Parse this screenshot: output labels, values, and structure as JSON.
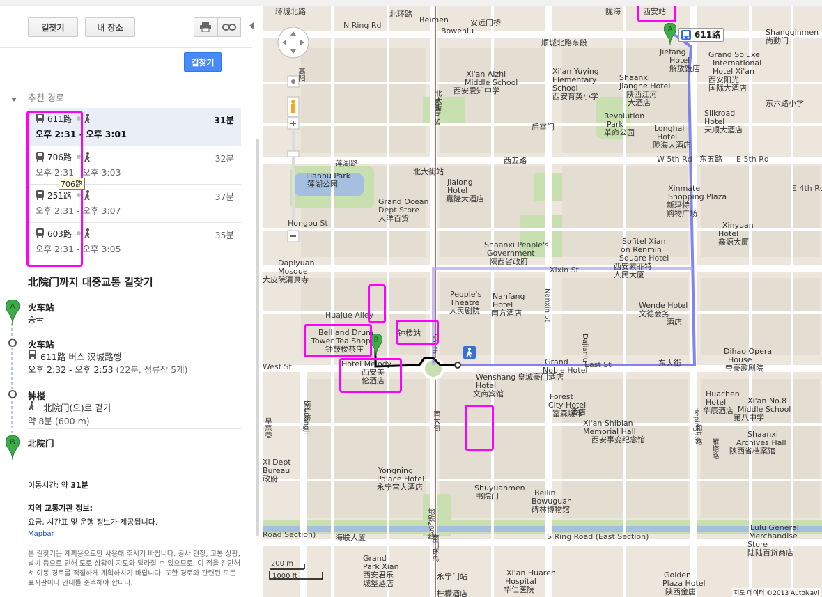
{
  "toolbar": {
    "directions_label": "길찾기",
    "my_places_label": "내 장소",
    "go_label": "길찾기"
  },
  "routes_header": "추천 경로",
  "routes": [
    {
      "line": "611路",
      "time": "오후 2:31 - 오후 3:01",
      "duration": "31분"
    },
    {
      "line": "706路",
      "time": "오후 2:31 - 오후 3:03",
      "duration": "32분",
      "tooltip": "706路"
    },
    {
      "line": "251路",
      "time": "오후 2:31 - 오후 3:07",
      "duration": "37분"
    },
    {
      "line": "603路",
      "time": "오후 2:31 - 오후 3:05",
      "duration": "35분"
    }
  ],
  "directions": {
    "title": "北院门까지 대중교통 길찾기",
    "steps": [
      {
        "name": "火车站",
        "sub": "중국",
        "marker": "A"
      },
      {
        "name": "火车站",
        "bus": "611路 버스 汉城路행",
        "time": "오후 2:32 - 오후 2:53",
        "detail": "(22분, 정류장 5개)"
      },
      {
        "name": "钟楼",
        "walk": "北院门(으)로 걷기",
        "dist": "약 8분 (600 m)"
      },
      {
        "name": "北院门",
        "marker": "B"
      }
    ],
    "travel_time_label": "이동시간: 약 ",
    "travel_time_value": "31분",
    "agency_title": "지역 교통기관 정보:",
    "agency_desc": "요금, 시간표 및 운행 정보가 제공됩니다.",
    "agency_link": "Mapbar",
    "disclaimer": "본 길찾기는 계획용으로만 사용해 주시기 바랍니다. 공사 현장, 교통 상황, 날씨 등으로 인해 도로 상황이 지도와 달라질 수 있으므로, 이 점을 감안해서 이동 경로를 적절하게 계획하시기 바랍니다. 또한 경로와 관련된 모든 표지판이나 안내를 준수해야 합니다."
  },
  "map": {
    "route_badge": "611路",
    "scale_m": "200 m",
    "scale_ft": "1000 ft",
    "copyright": "지도 데이터 ©2013 AutoNavi",
    "labels": [
      "环城北路",
      "陇海",
      "西安站",
      "N Ring Rd",
      "北环路",
      "Beimen",
      "Bowenlu",
      "安远门桥",
      "顺城北路东段",
      "Jiefang",
      "Hotel",
      "解放饭店",
      "Grand Soluxe",
      "International",
      "Hotel Xi'an",
      "西安阳光",
      "国际大酒店",
      "Shangqinmen",
      "尚勤门",
      "Xi'an Aizhi",
      "Middle School",
      "西安爱知中学",
      "Xi'an Yuying",
      "Elementary",
      "School",
      "西安育英小学",
      "Shaanxi",
      "Jianghe Hotel",
      "陕西江河",
      "大酒店",
      "东六路小学",
      "Revolution",
      "Park",
      "革命公园",
      "后宰门",
      "Longhai",
      "Hotel",
      "陇海大酒店",
      "Silkroad",
      "Hotel",
      "天顺大酒店",
      "莲湖路",
      "西五路",
      "W 5th Rd",
      "东五路",
      "E 5th Rd",
      "Lianhu Park",
      "莲湖公园",
      "北大街站",
      "Jialong",
      "Hotel",
      "嘉隆大酒店",
      "Grand Ocean",
      "Dept Store",
      "大洋百货",
      "Xinmate",
      "Shopping Plaza",
      "新玛特",
      "购物广场",
      "E 4th Rd",
      "Xinyuan",
      "Hotel",
      "鑫源大厦",
      "Shaanxi People's",
      "Government",
      "陕西省政府",
      "Sofitel Xian",
      "on Renmin",
      "Square Hotel",
      "西安索菲特",
      "人民大厦",
      "Xixin St",
      "Hongbu St",
      "Dapiyuan",
      "Mosque",
      "大皮院清真寺",
      "People's",
      "Theatre",
      "人民剧院",
      "Nanfang",
      "Hotel",
      "南方酒店",
      "Wende Hotel",
      "文德会务",
      "酒店",
      "Huajue Alley",
      "Bell and Drum",
      "Tower Tea Shop",
      "钟鼓楼茶庄",
      "钟楼站",
      "Hotel Melody",
      "西安美",
      "伦酒店",
      "West St",
      "Grand",
      "Noble Hotel",
      "皇城豪门酒店",
      "East St",
      "东大街",
      "Dihao Opera",
      "House",
      "帝豪歌剧院",
      "Wenshang",
      "Hotel",
      "文商宾馆",
      "Forest",
      "City Hotel",
      "富森城市",
      "酒店",
      "Huachen",
      "Hotel",
      "华辰酒店",
      "Xi'an Shibian",
      "Memorial Hall",
      "西安事变纪念馆",
      "Xi'an No.8",
      "Middle School",
      "第八中学",
      "Shaanxi",
      "Archives Hall",
      "陕西省档案馆",
      "Xi Dept",
      "Bureau",
      "政府",
      "Yongning",
      "Palace Hotel",
      "永宁宫大酒店",
      "Shuyuanmen",
      "书院门",
      "Beilin",
      "Bowuguan",
      "碑林博物馆",
      "S Ring Road (East Section)",
      "Lulu General",
      "Merchandise",
      "Store",
      "陆陆百货商店",
      "海联大厦",
      "Road Section)",
      "Grand",
      "Park Xian",
      "西安君乐",
      "城堡酒店",
      "永宁门站",
      "Xi'an Huaren",
      "Hospital",
      "华仁医院",
      "Golden",
      "Plaza Hotel",
      "陕西金唐",
      "柠檬酒店",
      "North St",
      "South St",
      "Nanxin St",
      "Dajianlu",
      "Heping Rd",
      "S Guangji",
      "南广济",
      "南大街",
      "北大街",
      "地铁2号线",
      "南门环岛",
      "和平路",
      "雁塔路",
      "高阳",
      "早慈巷"
    ]
  }
}
